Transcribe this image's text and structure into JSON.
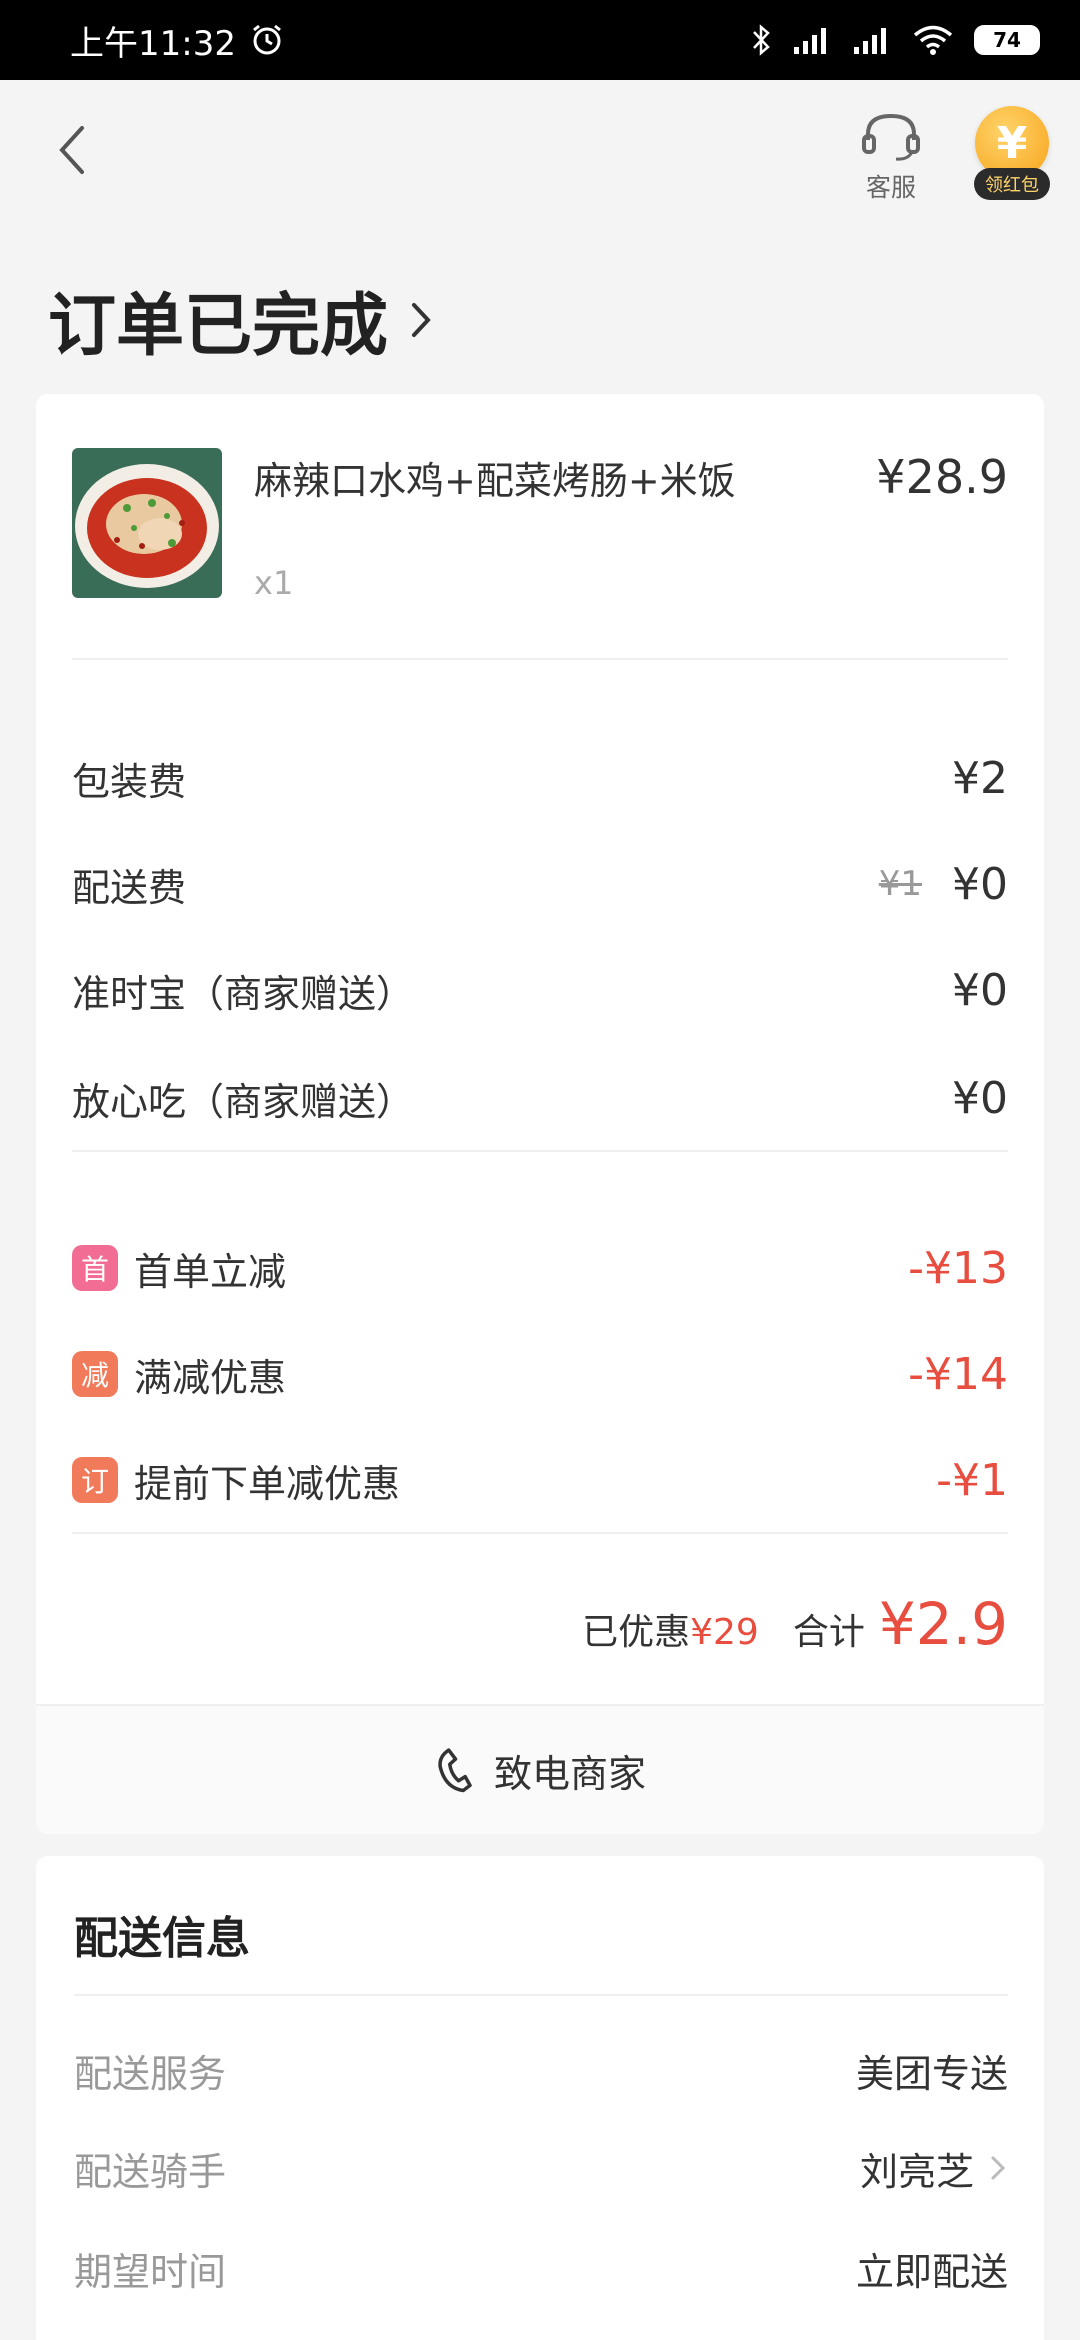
{
  "status_bar": {
    "time": "上午11:32",
    "battery": "74"
  },
  "header": {
    "service_label": "客服",
    "hongbao_coin": "¥",
    "hongbao_label": "领红包"
  },
  "order_status": {
    "title": "订单已完成"
  },
  "item": {
    "name": "麻辣口水鸡+配菜烤肠+米饭",
    "quantity": "x1",
    "price": "¥28.9"
  },
  "fees": [
    {
      "label": "包装费",
      "value": "¥2",
      "original": ""
    },
    {
      "label": "配送费",
      "value": "¥0",
      "original": "¥1"
    },
    {
      "label": "准时宝（商家赠送）",
      "value": "¥0",
      "original": ""
    },
    {
      "label": "放心吃（商家赠送）",
      "value": "¥0",
      "original": ""
    }
  ],
  "discounts": [
    {
      "badge": "首",
      "label": "首单立减",
      "value": "-¥13",
      "color": "#f26d93"
    },
    {
      "badge": "减",
      "label": "满减优惠",
      "value": "-¥14",
      "color": "#f07a5a"
    },
    {
      "badge": "订",
      "label": "提前下单减优惠",
      "value": "-¥1",
      "color": "#f07a5a"
    }
  ],
  "total": {
    "saved_label": "已优惠",
    "saved_value": "¥29",
    "label": "合计",
    "amount": "¥2.9"
  },
  "call_merchant": "致电商家",
  "delivery": {
    "title": "配送信息",
    "rows": [
      {
        "label": "配送服务",
        "value": "美团专送"
      },
      {
        "label": "配送骑手",
        "value": "刘亮芝"
      },
      {
        "label": "期望时间",
        "value": "立即配送"
      }
    ]
  },
  "colors": {
    "accent_red": "#e84e40",
    "coin_gold": "#f6a21a"
  }
}
